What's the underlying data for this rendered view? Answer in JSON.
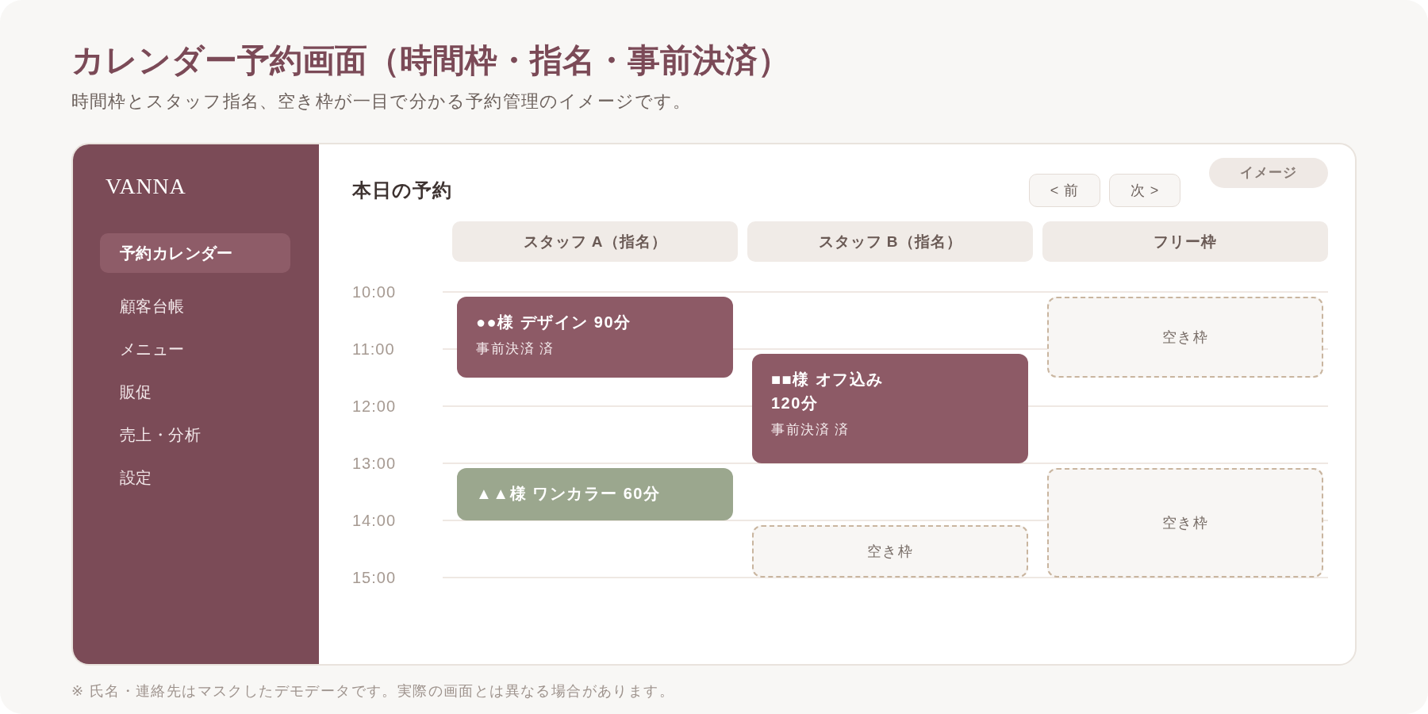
{
  "page": {
    "title": "カレンダー予約画面（時間枠・指名・事前決済）",
    "subtitle": "時間枠とスタッフ指名、空き枠が一目で分かる予約管理のイメージです。",
    "footnote": "※ 氏名・連絡先はマスクしたデモデータです。実際の画面とは異なる場合があります。"
  },
  "sidebar": {
    "brand": "VANNA",
    "items": [
      {
        "label": "予約カレンダー",
        "selected": true
      },
      {
        "label": "顧客台帳",
        "selected": false
      },
      {
        "label": "メニュー",
        "selected": false
      },
      {
        "label": "販促",
        "selected": false
      },
      {
        "label": "売上・分析",
        "selected": false
      },
      {
        "label": "設定",
        "selected": false
      }
    ]
  },
  "schedule": {
    "title": "本日の予約",
    "pager": [
      "< 前",
      "次 >"
    ],
    "badge": "イメージ",
    "times": [
      "10:00",
      "11:00",
      "12:00",
      "13:00",
      "14:00",
      "15:00"
    ],
    "columns": [
      {
        "header": "スタッフ A（指名）",
        "slots": [
          {
            "kind": "booking",
            "title": "●●様 デザイン 90分",
            "note": "事前決済 済",
            "color": "#8d5a66"
          },
          {
            "kind": "more"
          },
          {
            "kind": "more"
          },
          {
            "kind": "empty"
          },
          {
            "kind": "empty"
          },
          {
            "kind": "empty"
          },
          {
            "kind": "booking",
            "title": "▲▲様 ワンカラー 60分",
            "color": "#9ba78e"
          },
          {
            "kind": "more"
          },
          {
            "kind": "empty"
          },
          {
            "kind": "empty"
          }
        ]
      },
      {
        "header": "スタッフ B（指名）",
        "slots": [
          {
            "kind": "empty"
          },
          {
            "kind": "empty"
          },
          {
            "kind": "booking",
            "title": "■■様 オフ込み\n120分",
            "note": "事前決済 済",
            "color": "#8d5a66"
          },
          {
            "kind": "more"
          },
          {
            "kind": "more"
          },
          {
            "kind": "more"
          },
          {
            "kind": "empty"
          },
          {
            "kind": "empty"
          },
          {
            "kind": "free",
            "label": "空き枠"
          },
          {
            "kind": "more"
          }
        ]
      },
      {
        "header": "フリー枠",
        "slots": [
          {
            "kind": "free",
            "label": "空き枠"
          },
          {
            "kind": "more"
          },
          {
            "kind": "more"
          },
          {
            "kind": "empty"
          },
          {
            "kind": "empty"
          },
          {
            "kind": "empty"
          },
          {
            "kind": "free",
            "label": "空き枠"
          },
          {
            "kind": "more"
          },
          {
            "kind": "more"
          },
          {
            "kind": "more"
          }
        ]
      }
    ]
  }
}
